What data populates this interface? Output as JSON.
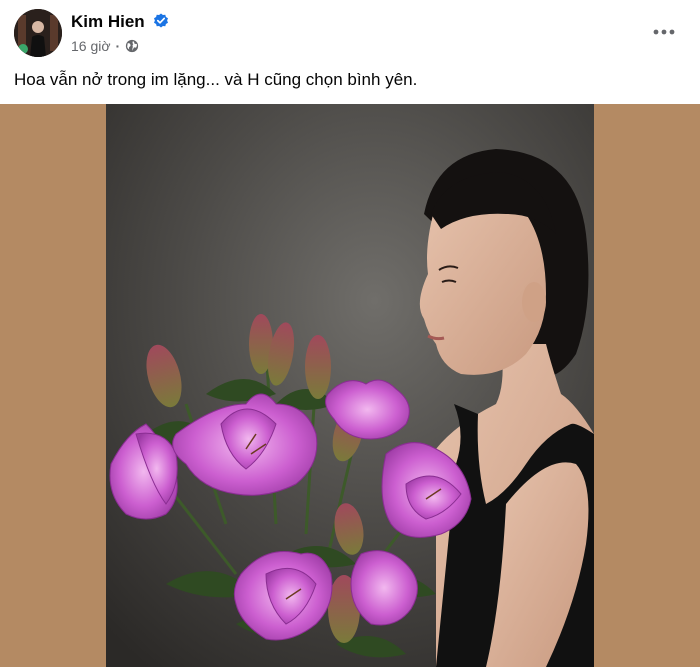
{
  "post": {
    "author": {
      "name": "Kim Hien",
      "verified": true,
      "avatar_icon": "profile-photo-avatar"
    },
    "meta": {
      "timestamp": "16 giờ",
      "separator": "·",
      "audience_icon": "globe-icon"
    },
    "more_icon": "more-horizontal-icon",
    "caption": "Hoa vẫn nở trong im lặng... và H cũng chọn bình yên.",
    "photo": {
      "subject": "photo-woman-with-lilies",
      "backdrop_color": "#b48a63"
    }
  },
  "colors": {
    "verified_badge": "#1b74e4",
    "secondary_text": "#65676b",
    "lily_pink": "#c55fc9"
  }
}
